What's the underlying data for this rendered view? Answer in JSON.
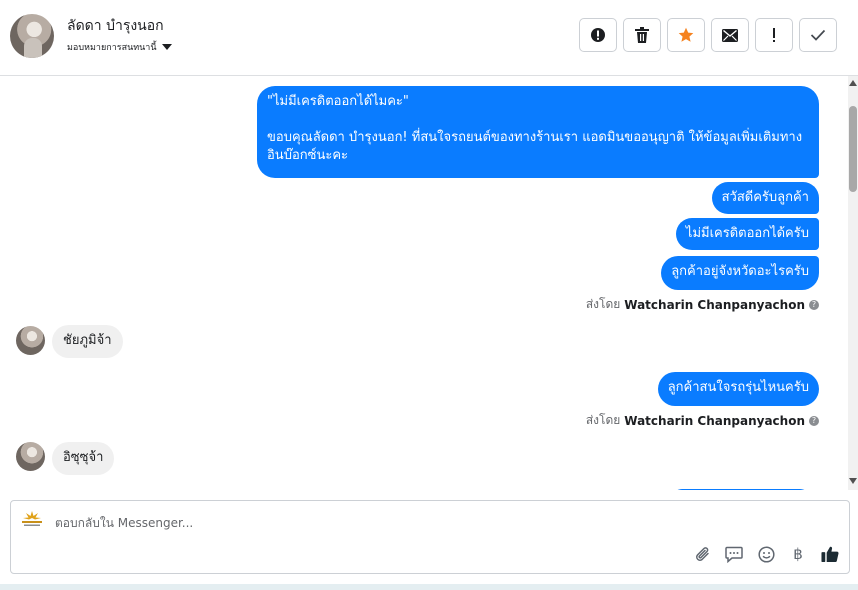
{
  "header": {
    "contact_name": "ลัดดา บำรุงนอก",
    "assign_label": "มอบหมายการสนทนานี้",
    "actions": [
      {
        "name": "spam-button",
        "icon": "alert-circle-icon"
      },
      {
        "name": "delete-button",
        "icon": "trash-icon"
      },
      {
        "name": "star-button",
        "icon": "star-icon"
      },
      {
        "name": "unread-button",
        "icon": "envelope-icon"
      },
      {
        "name": "follow-up-button",
        "icon": "exclamation-icon"
      },
      {
        "name": "done-button",
        "icon": "check-icon"
      }
    ]
  },
  "messages": {
    "m1": "\"ไม่มีเครดิตออกได้ไมคะ\"\n\nขอบคุณลัดดา บำรุงนอก! ที่สนใจรถยนต์ของทางร้านเรา แอดมินขออนุญาติ ให้ข้อมูลเพิ่มเติมทางอินบ๊อกซ์นะคะ",
    "m2": "สวัสดีครับลูกค้า",
    "m3": "ไม่มีเครดิตออกได้ครับ",
    "m4": "ลูกค้าอยู่จังหวัดอะไรครับ",
    "sent_by_prefix_1": "ส่งโดย",
    "sent_by_name_1": "Watcharin Chanpanyachon",
    "in1": "ชัยภูมิจ้า",
    "m5": "ลูกค้าสนใจรถรุ่นไหนครับ",
    "sent_by_prefix_2": "ส่งโดย",
    "sent_by_name_2": "Watcharin Chanpanyachon",
    "in2": "อิซุซุจ้า"
  },
  "composer": {
    "placeholder": "ตอบกลับใน Messenger...",
    "tools": [
      "paperclip-icon",
      "chat-bubble-icon",
      "smiley-icon",
      "baht-icon",
      "thumbs-up-icon"
    ],
    "baht_symbol": "฿"
  },
  "colors": {
    "outgoing_bubble": "#0a7cff",
    "incoming_bubble": "#f0f0f0",
    "star": "#f5821f"
  }
}
